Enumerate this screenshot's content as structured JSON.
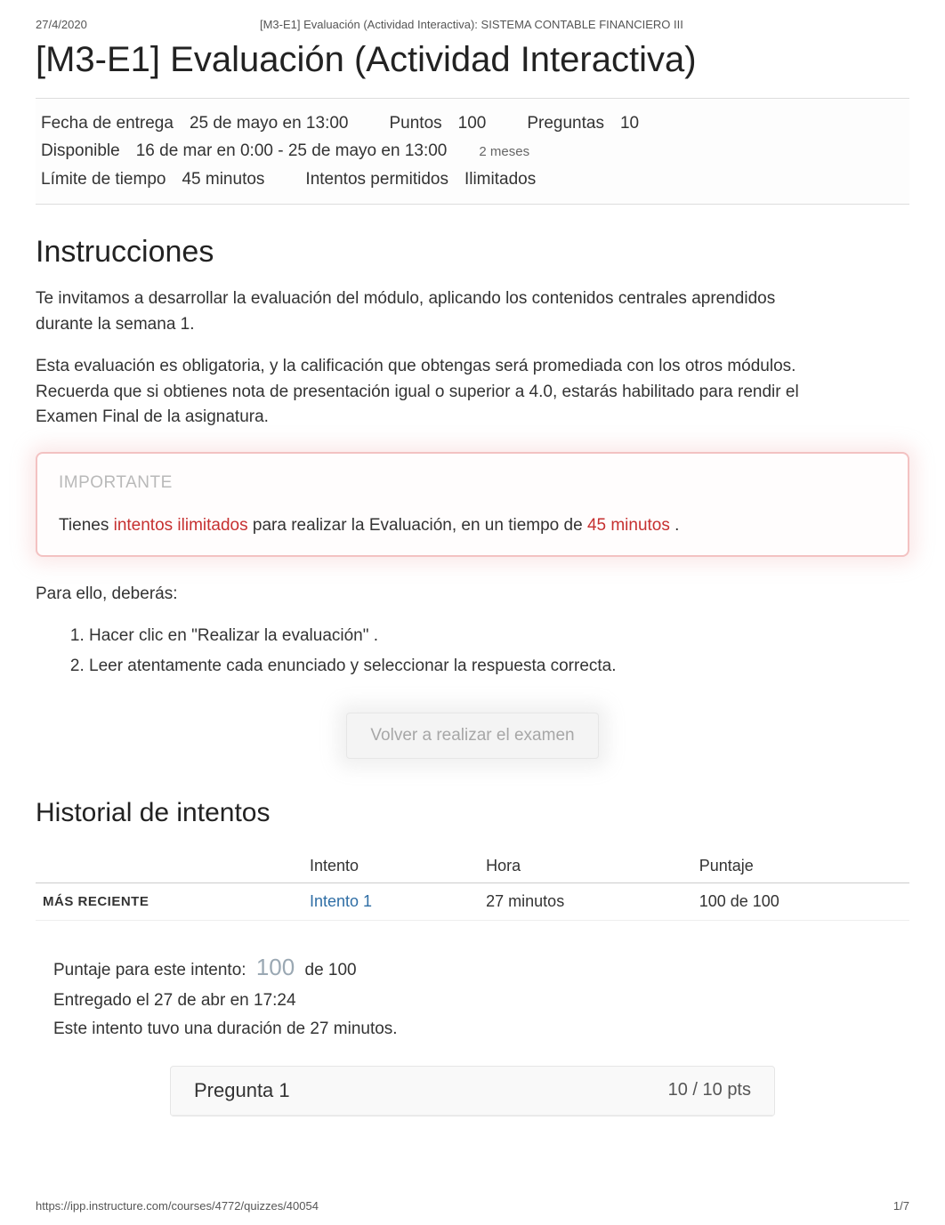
{
  "header": {
    "date": "27/4/2020",
    "doc_title": "[M3-E1] Evaluación (Actividad Interactiva): SISTEMA CONTABLE FINANCIERO III"
  },
  "title": "[M3-E1] Evaluación (Actividad Interactiva)",
  "meta": {
    "due_label": "Fecha de entrega",
    "due_value": "25 de mayo en 13:00",
    "points_label": "Puntos",
    "points_value": "100",
    "questions_label": "Preguntas",
    "questions_value": "10",
    "available_label": "Disponible",
    "available_value": "16 de mar en 0:00 - 25 de mayo en 13:00",
    "available_sub": "2 meses",
    "timelimit_label": "Límite de tiempo",
    "timelimit_value": "45 minutos",
    "attempts_label": "Intentos permitidos",
    "attempts_value": "Ilimitados"
  },
  "instr": {
    "heading": "Instrucciones",
    "p1": "Te invitamos a desarrollar la evaluación del módulo, aplicando los contenidos centrales aprendidos durante la semana 1.",
    "p2": "Esta evaluación es obligatoria, y la calificación que obtengas será promediada con los otros módulos. Recuerda que si obtienes nota de presentación igual o superior a 4.0, estarás habilitado para rendir el Examen Final de la asignatura."
  },
  "importante": {
    "title": "IMPORTANTE",
    "pre": "Tienes ",
    "red1": "intentos ilimitados",
    "mid": " para realizar la Evaluación, en un tiempo de ",
    "red2": "45 minutos",
    "post": " ."
  },
  "steps": {
    "intro": "Para ello, deberás:",
    "s1a": "Hacer clic en ",
    "s1b": "\"Realizar la evaluación\"",
    "s1c": " .",
    "s2": "Leer atentamente cada enunciado y seleccionar la respuesta correcta."
  },
  "retake_label": "Volver a realizar el examen",
  "history": {
    "heading": "Historial de intentos",
    "cols": {
      "c0": "",
      "c1": "Intento",
      "c2": "Hora",
      "c3": "Puntaje"
    },
    "rows": [
      {
        "tag": "MÁS RECIENTE",
        "attempt": "Intento 1",
        "time": "27 minutos",
        "score": "100 de 100"
      }
    ]
  },
  "score": {
    "line1a": "Puntaje para este intento: ",
    "big": "100",
    "line1b": " de 100",
    "line2": "Entregado el 27 de abr en 17:24",
    "line3": "Este intento tuvo una duración de 27 minutos."
  },
  "question": {
    "title": "Pregunta 1",
    "pts": "10 / 10 pts"
  },
  "footer": {
    "url": "https://ipp.instructure.com/courses/4772/quizzes/40054",
    "page": "1/7"
  }
}
